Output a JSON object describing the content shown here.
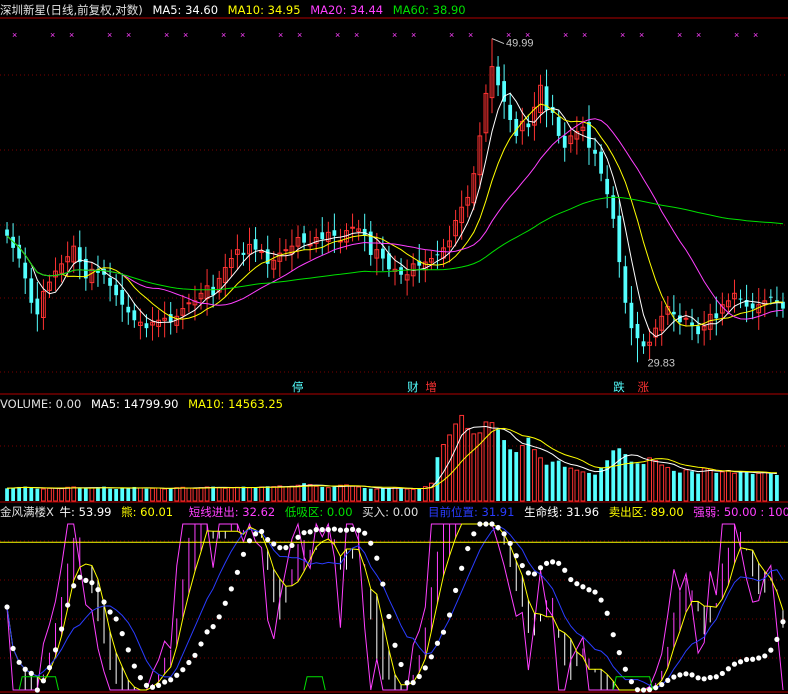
{
  "header": {
    "stock_label": "深圳新星(日线,前复权,对数)",
    "ma5": "MA5: 34.60",
    "ma10": "MA10: 34.95",
    "ma20": "MA20: 34.44",
    "ma60": "MA60: 38.90"
  },
  "volume_header": {
    "label": "VOLUME: 0.00",
    "ma5": "MA5: 14799.90",
    "ma10": "MA10: 14563.25"
  },
  "indicator_header": {
    "name": "金风满楼X",
    "niu": "牛: 53.99",
    "xiong": "熊: 60.01",
    "duanxian": "短线进出: 32.62",
    "dixiqu": "低吸区: 0.00",
    "mairu": "买入: 0.00",
    "mqwz": "目前位置: 31.91",
    "shengming": "生命线: 31.96",
    "maichu": "卖出区: 89.00",
    "qiangruo": "强弱: 50.00 : 100.00"
  },
  "colors": {
    "up": "#ff3232",
    "down": "#54ffff",
    "ma5": "#ffffff",
    "ma10": "#ffff00",
    "ma20": "#ff40ff",
    "ma60": "#00e000",
    "axis": "#b00000",
    "grid": "#7a0000"
  },
  "chart_data": [
    {
      "type": "candlestick",
      "title": "深圳新星(日线,前复权,对数)",
      "high_label": "49.99",
      "low_label": "29.83",
      "series_names": [
        "MA5",
        "MA10",
        "MA20",
        "MA60"
      ],
      "markers": [
        {
          "label": "停",
          "index": 48,
          "color": "#54ffff"
        },
        {
          "label": "财",
          "index": 67,
          "color": "#54ffff"
        },
        {
          "label": "增",
          "index": 70,
          "color": "#ff3232"
        },
        {
          "label": "跌",
          "index": 101,
          "color": "#54ffff"
        },
        {
          "label": "涨",
          "index": 105,
          "color": "#ff3232"
        }
      ],
      "closes": [
        36.5,
        35.8,
        35.2,
        34.1,
        32.8,
        32.2,
        33.4,
        33.9,
        34.5,
        34.9,
        35.3,
        35.9,
        35.0,
        34.1,
        34.6,
        34.4,
        34.3,
        33.7,
        33.2,
        32.7,
        32.3,
        31.9,
        31.8,
        31.5,
        31.8,
        31.9,
        32.0,
        31.8,
        32.1,
        32.5,
        32.8,
        32.9,
        33.3,
        33.7,
        33.2,
        34.1,
        34.7,
        35.2,
        35.7,
        35.4,
        36.0,
        35.7,
        35.6,
        34.9,
        35.1,
        35.5,
        35.7,
        35.9,
        36.4,
        36.1,
        36.0,
        36.4,
        36.3,
        36.7,
        36.5,
        36.2,
        36.8,
        37.0,
        36.9,
        36.5,
        35.4,
        35.7,
        35.2,
        34.6,
        34.6,
        34.3,
        34.3,
        34.9,
        34.8,
        35.0,
        35.2,
        35.4,
        35.8,
        36.2,
        37.4,
        38.2,
        38.8,
        40.3,
        42.8,
        45.8,
        47.8,
        46.4,
        45.2,
        43.9,
        42.8,
        43.8,
        43.4,
        44.8,
        46.4,
        44.6,
        44.4,
        42.8,
        42.0,
        42.8,
        43.1,
        43.4,
        42.0,
        41.6,
        40.3,
        39.0,
        37.5,
        35.0,
        32.8,
        31.5,
        31.0,
        30.6,
        30.8,
        31.5,
        32.1,
        32.6,
        32.2,
        31.8,
        32.0,
        31.6,
        31.2,
        31.6,
        32.2,
        32.0,
        32.7,
        32.9,
        33.3,
        33.0,
        32.6,
        32.5,
        32.7,
        32.9,
        33.1,
        32.8,
        32.5
      ],
      "ma_values_at_last_bar": {
        "MA5": 34.6,
        "MA10": 34.95,
        "MA20": 34.44,
        "MA60": 38.9
      }
    },
    {
      "type": "bar",
      "title": "VOLUME",
      "series_names": [
        "MA5",
        "MA10"
      ],
      "values": [
        3700,
        3900,
        4100,
        4200,
        3800,
        3600,
        3500,
        3700,
        3800,
        3600,
        4000,
        4100,
        3900,
        3700,
        3800,
        4000,
        4200,
        3600,
        3500,
        3700,
        3900,
        4100,
        3800,
        3600,
        3700,
        3800,
        3500,
        3700,
        3900,
        4000,
        3800,
        3700,
        3900,
        4100,
        4200,
        3900,
        3700,
        3800,
        4000,
        4200,
        3900,
        3800,
        4100,
        4300,
        4200,
        4400,
        4100,
        4300,
        4600,
        5200,
        4800,
        4300,
        4100,
        3900,
        4200,
        4600,
        4700,
        4300,
        4100,
        3800,
        3600,
        3500,
        3700,
        3800,
        3900,
        3600,
        3500,
        3400,
        3700,
        4200,
        5200,
        12800,
        16500,
        19300,
        22500,
        25000,
        21200,
        19600,
        19900,
        23100,
        22900,
        20900,
        17800,
        15100,
        14300,
        16200,
        18500,
        15000,
        12600,
        10600,
        11500,
        11800,
        10000,
        9600,
        9000,
        8500,
        8200,
        7700,
        9800,
        11900,
        14800,
        15400,
        13700,
        11500,
        11000,
        10800,
        12600,
        11800,
        10500,
        9800,
        8800,
        8300,
        9100,
        8700,
        8000,
        9600,
        9300,
        8200,
        8500,
        8900,
        8100,
        8600,
        8300,
        7900,
        8100,
        8400,
        8000,
        7600
      ]
    },
    {
      "type": "line",
      "title": "金风满楼X",
      "series_names": [
        "牛",
        "熊",
        "短线进出",
        "目前位置",
        "生命线"
      ],
      "last_values": {
        "牛": 53.99,
        "熊": 60.01,
        "短线进出": 32.62,
        "低吸区": 0.0,
        "买入": 0.0,
        "目前位置": 31.91,
        "生命线": 31.96,
        "卖出区": 89.0
      },
      "strength": "50.00 : 100.00"
    }
  ]
}
